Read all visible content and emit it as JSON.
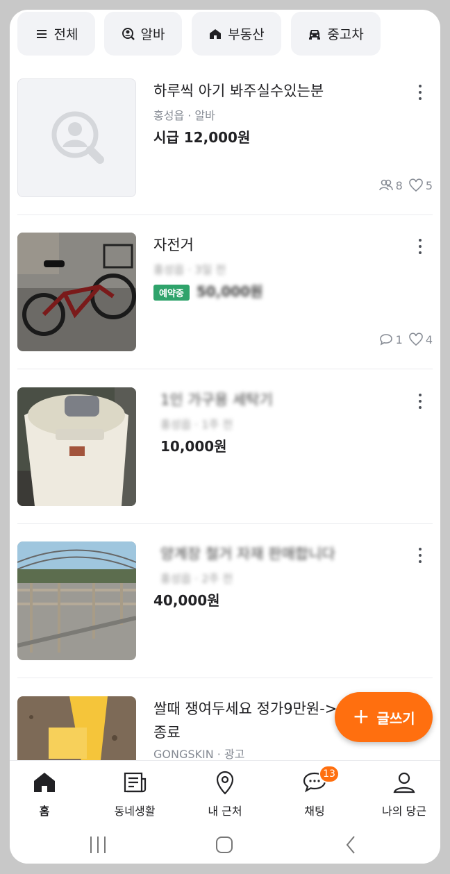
{
  "categories": [
    {
      "label": "전체",
      "icon": "menu-icon"
    },
    {
      "label": "알바",
      "icon": "job-search-icon"
    },
    {
      "label": "부동산",
      "icon": "house-icon"
    },
    {
      "label": "중고차",
      "icon": "car-icon"
    }
  ],
  "items": [
    {
      "title": "하루씩 아기 봐주실수있는분",
      "meta": "홍성읍 · 알바",
      "price": "시급 12,000원",
      "chats": "8",
      "likes": "5",
      "chat_icon": "people-icon"
    },
    {
      "title": "자전거",
      "meta_blur": "홍성읍 · 3일 전",
      "badge": "예약중",
      "price_blur": "50,000원",
      "chats": "1",
      "likes": "4",
      "chat_icon": "chat-bubble-icon"
    },
    {
      "title_blur": "1인 가구용 세탁기",
      "meta_blur": "홍성읍 · 1주 전",
      "price": "10,000원"
    },
    {
      "title_blur": "양계장 철거 자재 판매합니다",
      "meta_blur": "홍성읍 · 2주 전",
      "price": "40,000원"
    },
    {
      "title_line1": "쌀때 쟁여두세요 정가9만원->9",
      "title_line2": "종료",
      "meta": "GONGSKIN · 광고"
    }
  ],
  "fab_label": "글쓰기",
  "nav": [
    {
      "label": "홈",
      "icon": "home-icon",
      "active": true
    },
    {
      "label": "동네생활",
      "icon": "newspaper-icon"
    },
    {
      "label": "내 근처",
      "icon": "location-pin-icon"
    },
    {
      "label": "채팅",
      "icon": "chat-icon",
      "badge": "13"
    },
    {
      "label": "나의 당근",
      "icon": "profile-icon"
    }
  ],
  "colors": {
    "accent": "#ff6f0f",
    "badge_green": "#2fa36b",
    "text_secondary": "#868b94"
  }
}
